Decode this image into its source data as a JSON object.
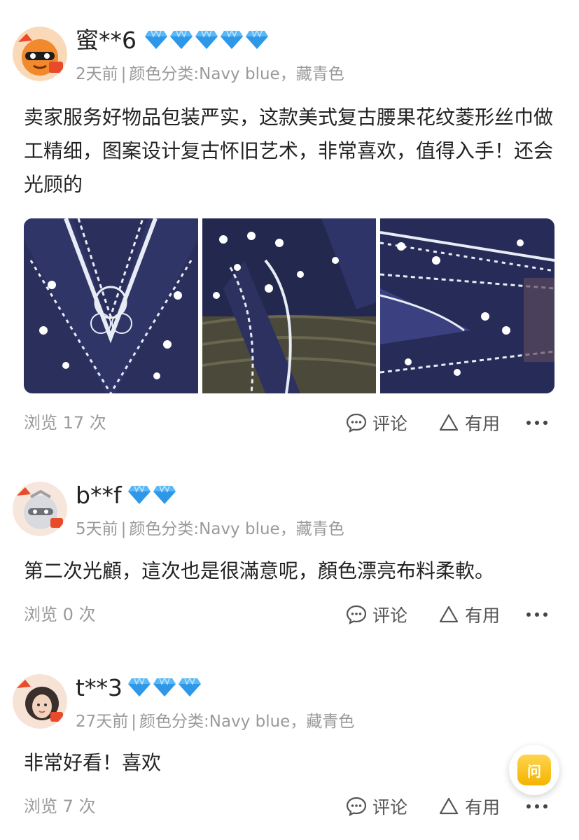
{
  "reviews": [
    {
      "username": "蜜**6",
      "diamond_count": 5,
      "date": "2天前",
      "separator": "|",
      "variant": "颜色分类:Navy blue，藏青色",
      "text": "卖家服务好物品包装严实，这款美式复古腰果花纹菱形丝巾做工精细，图案设计复古怀旧艺术，非常喜欢，值得入手！还会光顾的",
      "views": "浏览 17 次",
      "photo_count": 3
    },
    {
      "username": "b**f",
      "diamond_count": 2,
      "date": "5天前",
      "separator": "|",
      "variant": "颜色分类:Navy blue，藏青色",
      "text": "第二次光顧，這次也是很滿意呢，顏色漂亮布料柔軟。",
      "views": "浏览 0 次"
    },
    {
      "username": "t**3",
      "diamond_count": 3,
      "date": "27天前",
      "separator": "|",
      "variant": "颜色分类:Navy blue，藏青色",
      "text": "非常好看！喜欢",
      "views": "浏览 7 次"
    }
  ],
  "actions": {
    "comment_label": "评论",
    "useful_label": "有用",
    "more_icon": "more-icon",
    "comment_icon": "comment-icon",
    "useful_icon": "triangle-icon"
  },
  "ask_button": {
    "label": "问"
  },
  "colors": {
    "text": "#222222",
    "muted": "#9a9a9a",
    "diamond": "#4fb3f6",
    "fabric_navy": "#2a2f5c",
    "ask_yellow": "#f4b400"
  }
}
